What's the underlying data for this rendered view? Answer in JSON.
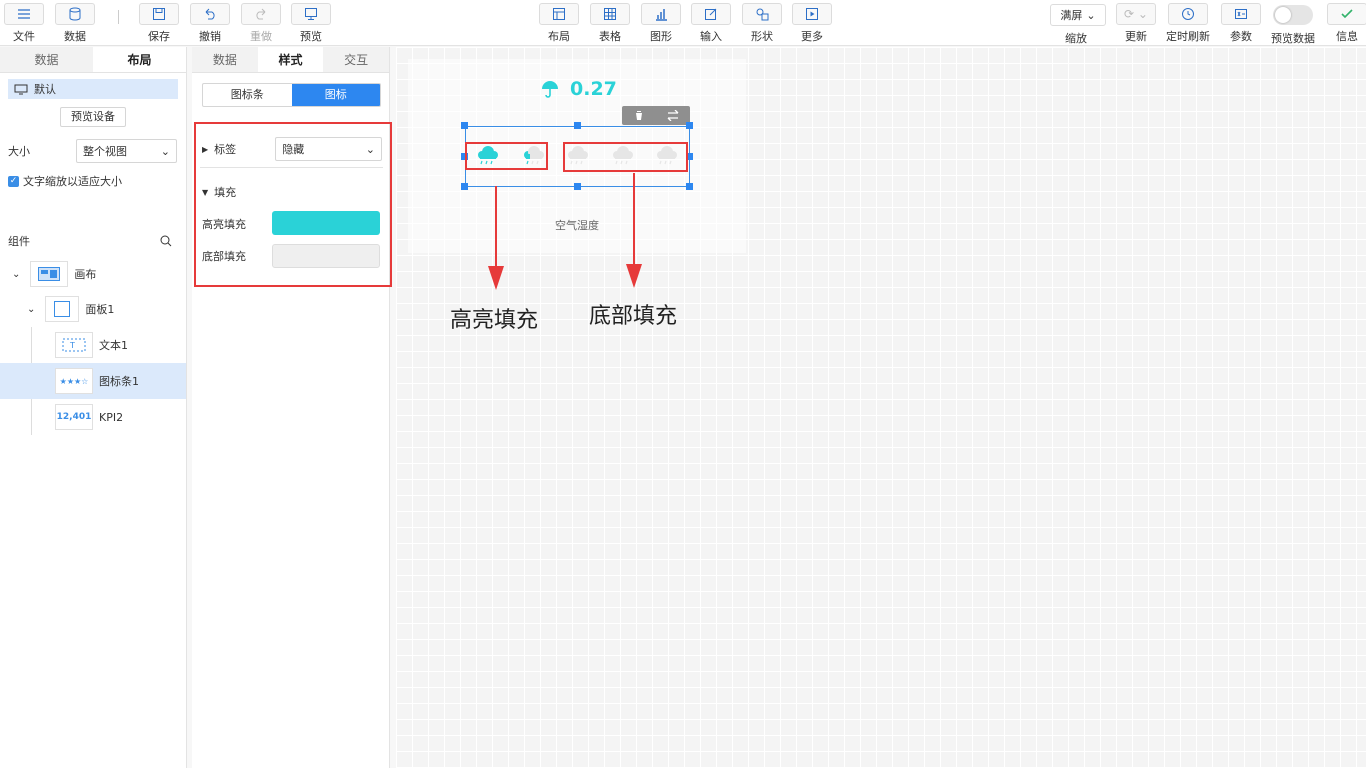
{
  "toolbar": {
    "file": "文件",
    "data": "数据",
    "save": "保存",
    "undo": "撤销",
    "redo": "重做",
    "preview": "预览",
    "layout": "布局",
    "table": "表格",
    "chart": "图形",
    "input": "输入",
    "shape": "形状",
    "more": "更多",
    "zoom_value": "满屏",
    "zoom": "缩放",
    "refresh": "更新",
    "timed_refresh": "定时刷新",
    "params": "参数",
    "preview_data": "预览数据",
    "info": "信息"
  },
  "left": {
    "tabs": [
      "数据",
      "布局"
    ],
    "device": "默认",
    "preview_device": "预览设备",
    "size_label": "大小",
    "size_value": "整个视图",
    "text_scale": "文字缩放以适应大小",
    "components": "组件",
    "tree": [
      "画布",
      "面板1",
      "文本1",
      "图标条1",
      "KPI2"
    ],
    "kpi_thumb": "12,401"
  },
  "mid": {
    "tabs": [
      "数据",
      "样式",
      "交互"
    ],
    "seg": [
      "图标条",
      "图标"
    ],
    "label": "标签",
    "label_value": "隐藏",
    "fill": "填充",
    "highlight_fill": "高亮填充",
    "bottom_fill": "底部填充",
    "highlight_color": "#2ad2d7",
    "bottom_color": "#efefef"
  },
  "canvas": {
    "kpi_value": "0.27",
    "subtitle": "空气湿度",
    "annot_highlight": "高亮填充",
    "annot_bottom": "底部填充",
    "highlight_color": "#2ad2d7",
    "bottom_color": "#e6e6e6"
  }
}
